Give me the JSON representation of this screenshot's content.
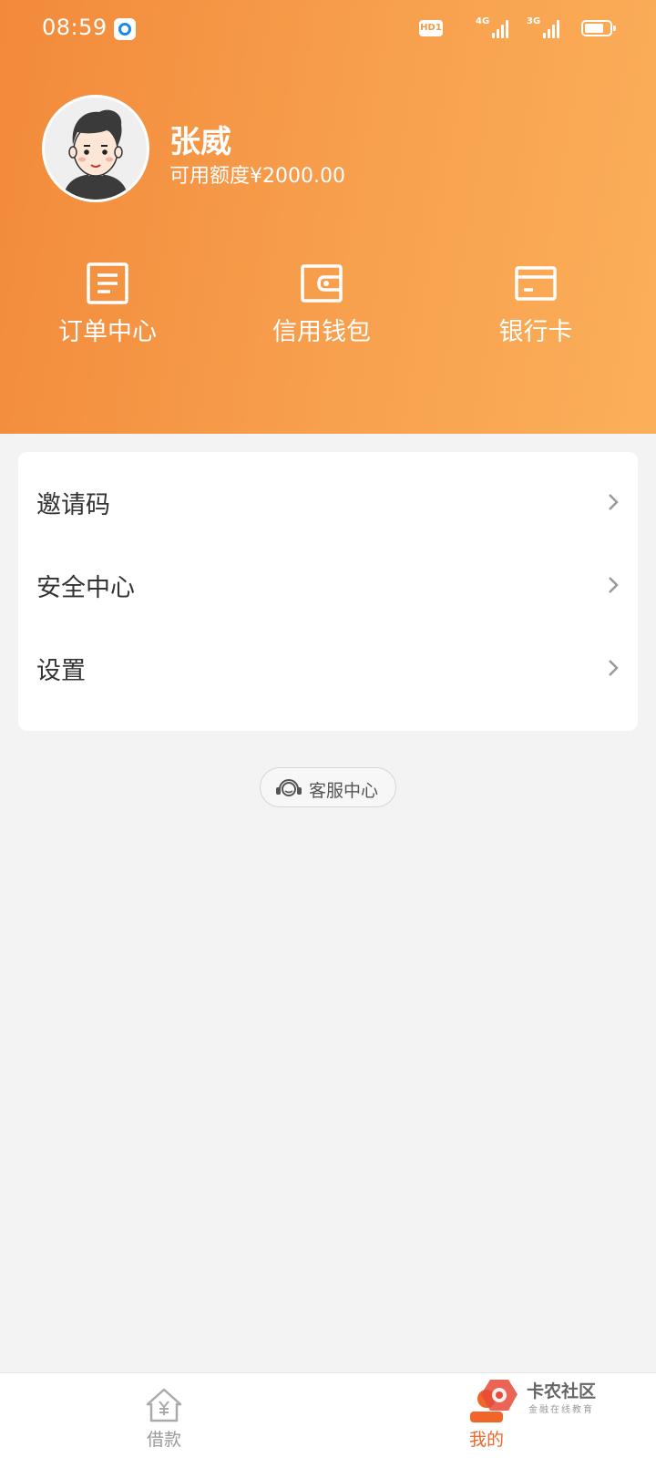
{
  "status_bar": {
    "time": "08:59",
    "hd_badge": "HD1",
    "network_1": "4G",
    "network_2": "3G",
    "icons": [
      "app-notification-icon",
      "signal-icon",
      "battery-icon"
    ]
  },
  "profile": {
    "name": "张威",
    "credit_line": "可用额度¥2000.00",
    "avatar": "cartoon-man-avatar"
  },
  "quick_actions": [
    {
      "label": "订单中心",
      "icon": "order-list-icon"
    },
    {
      "label": "信用钱包",
      "icon": "wallet-icon"
    },
    {
      "label": "银行卡",
      "icon": "bank-card-icon"
    }
  ],
  "menu": [
    {
      "label": "邀请码",
      "icon": "chevron-right-icon"
    },
    {
      "label": "安全中心",
      "icon": "chevron-right-icon"
    },
    {
      "label": "设置",
      "icon": "chevron-right-icon"
    }
  ],
  "customer_service": {
    "label": "客服中心",
    "icon": "headset-icon"
  },
  "bottom_nav": [
    {
      "label": "借款",
      "icon": "home-yen-icon",
      "active": false
    },
    {
      "label": "我的",
      "icon": "profile-icon",
      "active": true
    }
  ],
  "watermark": {
    "title": "卡农社区",
    "subtitle": "金融在线教育"
  },
  "colors": {
    "header_start": "#f28a3a",
    "header_end": "#fcaf59",
    "active_tab": "#f0652a",
    "background": "#f3f3f3"
  }
}
